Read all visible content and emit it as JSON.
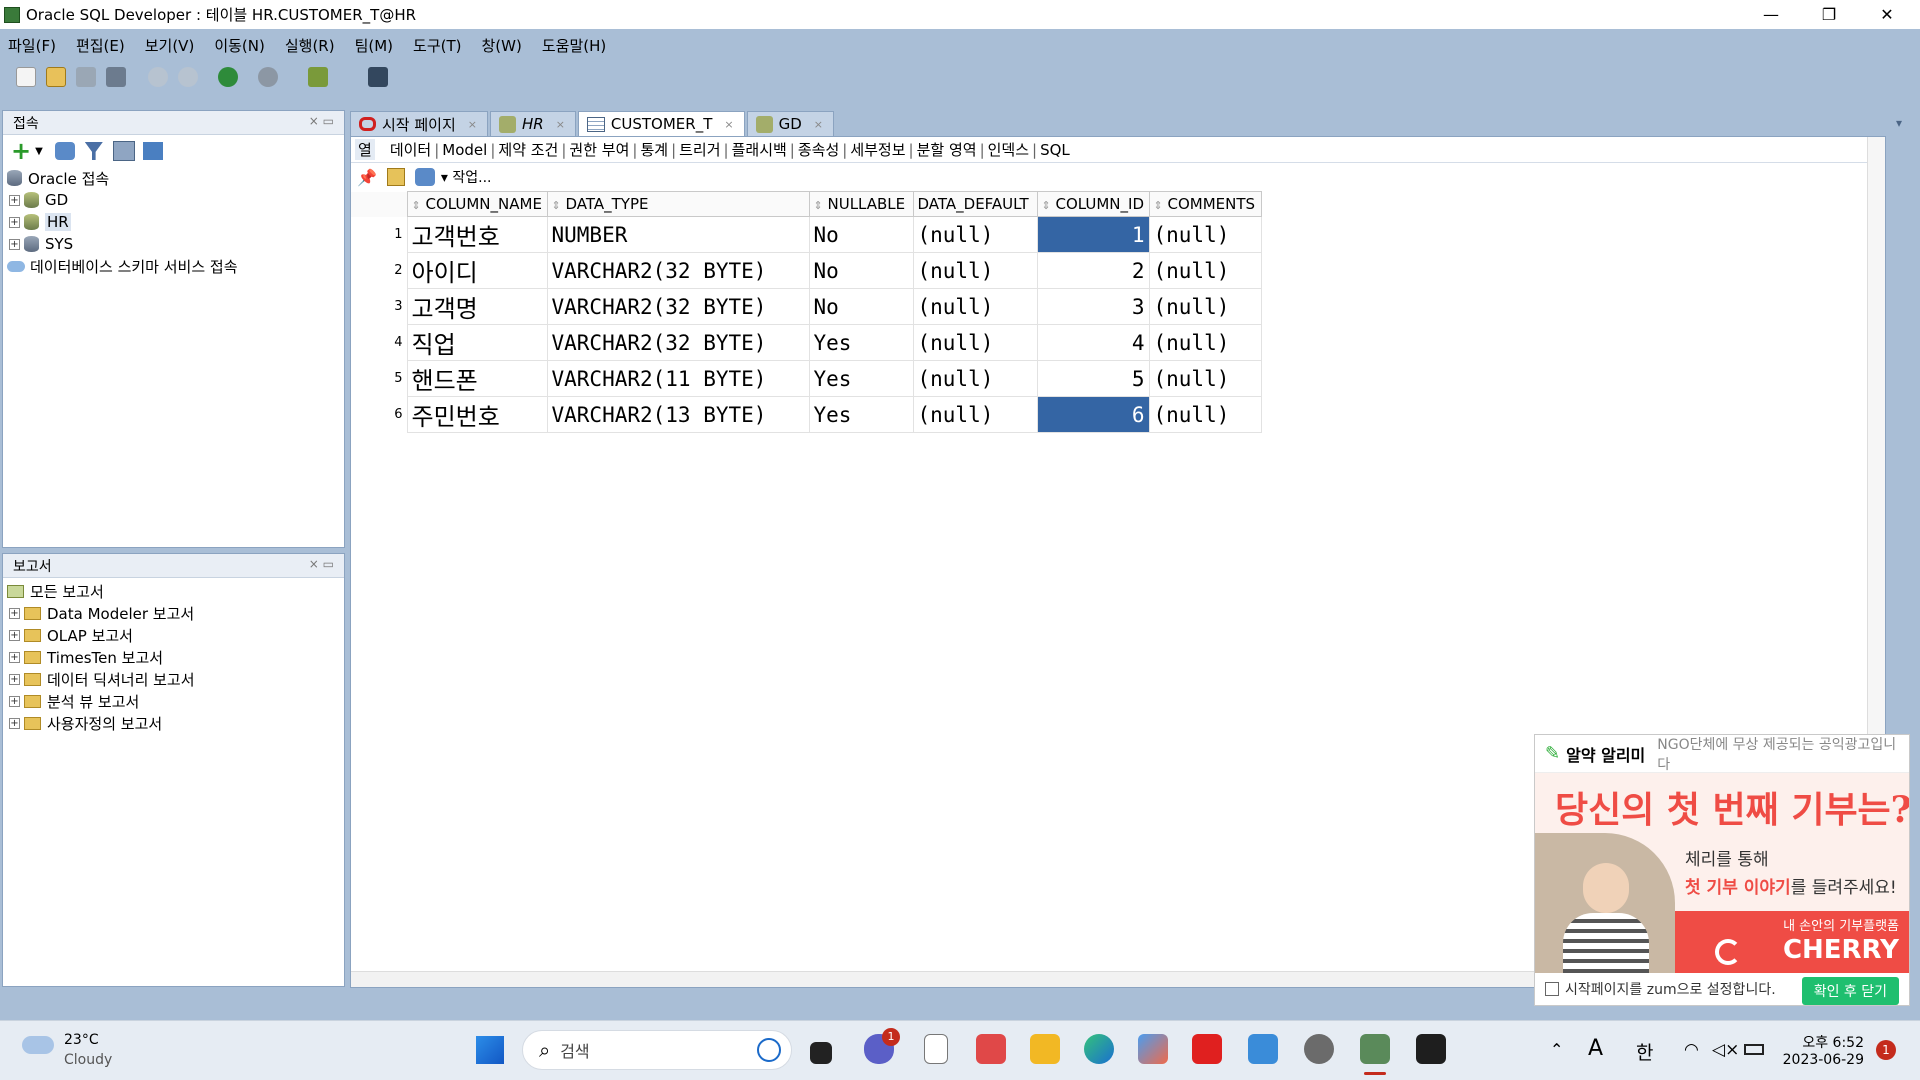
{
  "window": {
    "title": "Oracle SQL Developer : 테이블 HR.CUSTOMER_T@HR",
    "controls": [
      "—",
      "❐",
      "✕"
    ]
  },
  "menu": [
    "파일(F)",
    "편집(E)",
    "보기(V)",
    "이동(N)",
    "실행(R)",
    "팀(M)",
    "도구(T)",
    "창(W)",
    "도움말(H)"
  ],
  "connections_panel": {
    "title": "접속",
    "root": "Oracle 접속",
    "items": [
      "GD",
      "HR",
      "SYS"
    ],
    "cloud": "데이터베이스 스키마 서비스 접속"
  },
  "reports_panel": {
    "title": "보고서",
    "root": "모든 보고서",
    "items": [
      "Data Modeler 보고서",
      "OLAP 보고서",
      "TimesTen 보고서",
      "데이터 딕셔너리 보고서",
      "분석 뷰 보고서",
      "사용자정의 보고서"
    ]
  },
  "doc_tabs": [
    {
      "label": "시작 페이지",
      "icon": "oracle-icon"
    },
    {
      "label": "HR",
      "icon": "sql-worksheet-icon"
    },
    {
      "label": "CUSTOMER_T",
      "icon": "table-icon"
    },
    {
      "label": "GD",
      "icon": "sql-worksheet-icon"
    }
  ],
  "sub_tabs": [
    "열",
    "데이터",
    "Model",
    "제약 조건",
    "권한 부여",
    "통계",
    "트리거",
    "플래시백",
    "종속성",
    "세부정보",
    "분할 영역",
    "인덱스",
    "SQL"
  ],
  "actions_label": "▾ 작업...",
  "grid": {
    "headers": [
      "COLUMN_NAME",
      "DATA_TYPE",
      "NULLABLE",
      "DATA_DEFAULT",
      "COLUMN_ID",
      "COMMENTS"
    ],
    "rows": [
      {
        "n": "1",
        "name": "고객번호",
        "type": "NUMBER",
        "nullable": "No",
        "default": "(null)",
        "id": "1",
        "comments": "(null)"
      },
      {
        "n": "2",
        "name": "아이디",
        "type": "VARCHAR2(32 BYTE)",
        "nullable": "No",
        "default": "(null)",
        "id": "2",
        "comments": "(null)"
      },
      {
        "n": "3",
        "name": "고객명",
        "type": "VARCHAR2(32 BYTE)",
        "nullable": "No",
        "default": "(null)",
        "id": "3",
        "comments": "(null)"
      },
      {
        "n": "4",
        "name": "직업",
        "type": "VARCHAR2(32 BYTE)",
        "nullable": "Yes",
        "default": "(null)",
        "id": "4",
        "comments": "(null)"
      },
      {
        "n": "5",
        "name": "핸드폰",
        "type": "VARCHAR2(11 BYTE)",
        "nullable": "Yes",
        "default": "(null)",
        "id": "5",
        "comments": "(null)"
      },
      {
        "n": "6",
        "name": "주민번호",
        "type": "VARCHAR2(13 BYTE)",
        "nullable": "Yes",
        "default": "(null)",
        "id": "6",
        "comments": "(null)"
      }
    ]
  },
  "ad": {
    "brand": "알약 알리미",
    "notice": "NGO단체에 무상 제공되는 공익광고입니다",
    "headline": "당신의 첫 번째 기부는?",
    "line1": "체리를 통해",
    "line2_highlight": "첫 기부 이야기",
    "line2_rest": "를 들려주세요!",
    "sub": "내 손안의 기부플랫폼",
    "logo": "CHERRY",
    "checkbox_label": "시작페이지를 zum으로 설정합니다.",
    "close_button": "확인 후 닫기"
  },
  "taskbar": {
    "weather_temp": "23°C",
    "weather_desc": "Cloudy",
    "search_placeholder": "검색",
    "chat_badge": "1",
    "time": "오후 6:52",
    "date": "2023-06-29",
    "notif_badge": "1",
    "ime_a": "A",
    "ime_han": "한"
  },
  "colors": {
    "accent": "#3465a4",
    "ide_bg": "#a9bed6",
    "ad_red": "#ef4c45",
    "ad_green": "#1fbf6f"
  }
}
